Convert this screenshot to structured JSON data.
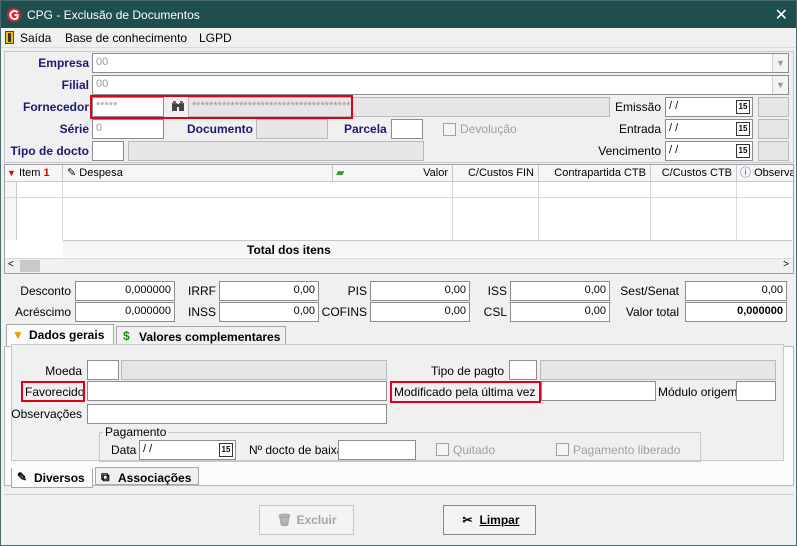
{
  "window": {
    "title": "CPG - Exclusão de Documentos"
  },
  "menu": {
    "items": [
      "Saída",
      "Base de conhecimento",
      "LGPD"
    ]
  },
  "header": {
    "empresa": {
      "label": "Empresa",
      "value": "00"
    },
    "filial": {
      "label": "Filial",
      "value": "00"
    },
    "fornecedor": {
      "label": "Fornecedor",
      "code": "*****",
      "name": "*************************************"
    },
    "serie": {
      "label": "Série",
      "value": "0"
    },
    "documento": {
      "label": "Documento",
      "value": ""
    },
    "parcela": {
      "label": "Parcela",
      "value": ""
    },
    "devolucao": {
      "label": "Devolução",
      "checked": false
    },
    "tipo_docto": {
      "label": "Tipo de docto",
      "code": "",
      "desc": ""
    },
    "emissao": {
      "label": "Emissão",
      "value": " / /"
    },
    "entrada": {
      "label": "Entrada",
      "value": " / /"
    },
    "vencimento": {
      "label": "Vencimento",
      "value": " / /"
    }
  },
  "grid": {
    "columns": [
      "Item",
      "Despesa",
      "Valor",
      "C/Custos FIN",
      "Contrapartida CTB",
      "C/Custos CTB",
      "Observa"
    ],
    "total_label": "Total dos itens"
  },
  "taxes": {
    "desconto": {
      "label": "Desconto",
      "value": "0,000000"
    },
    "acrescimo": {
      "label": "Acréscimo",
      "value": "0,000000"
    },
    "irrf": {
      "label": "IRRF",
      "value": "0,00"
    },
    "inss": {
      "label": "INSS",
      "value": "0,00"
    },
    "pis": {
      "label": "PIS",
      "value": "0,00"
    },
    "cofins": {
      "label": "COFINS",
      "value": "0,00"
    },
    "iss": {
      "label": "ISS",
      "value": "0,00"
    },
    "csl": {
      "label": "CSL",
      "value": "0,00"
    },
    "sest_senat": {
      "label": "Sest/Senat",
      "value": "0,00"
    },
    "valor_total": {
      "label": "Valor total",
      "value": "0,000000"
    }
  },
  "top_tabs": [
    "Dados gerais",
    "Valores complementares"
  ],
  "dados_gerais": {
    "moeda": {
      "label": "Moeda"
    },
    "tipo_pagto": {
      "label": "Tipo de pagto"
    },
    "favorecido": {
      "label": "Favorecido"
    },
    "modificado": {
      "label": "Modificado pela última vez por"
    },
    "modulo_origem": {
      "label": "Módulo origem"
    },
    "observacoes": {
      "label": "Observações"
    },
    "pagamento": {
      "group": "Pagamento",
      "data_label": "Data",
      "data_value": " / /",
      "baixa_label": "Nº docto de baixa",
      "quitado": "Quitado",
      "liberado": "Pagamento liberado"
    }
  },
  "bottom_tabs": [
    "Diversos",
    "Associações"
  ],
  "buttons": {
    "excluir": "Excluir",
    "limpar": "Limpar"
  },
  "colors": {
    "titlebar": "#1e4e4e",
    "highlight": "#e0001a",
    "label_blue": "#1a1a6e"
  }
}
